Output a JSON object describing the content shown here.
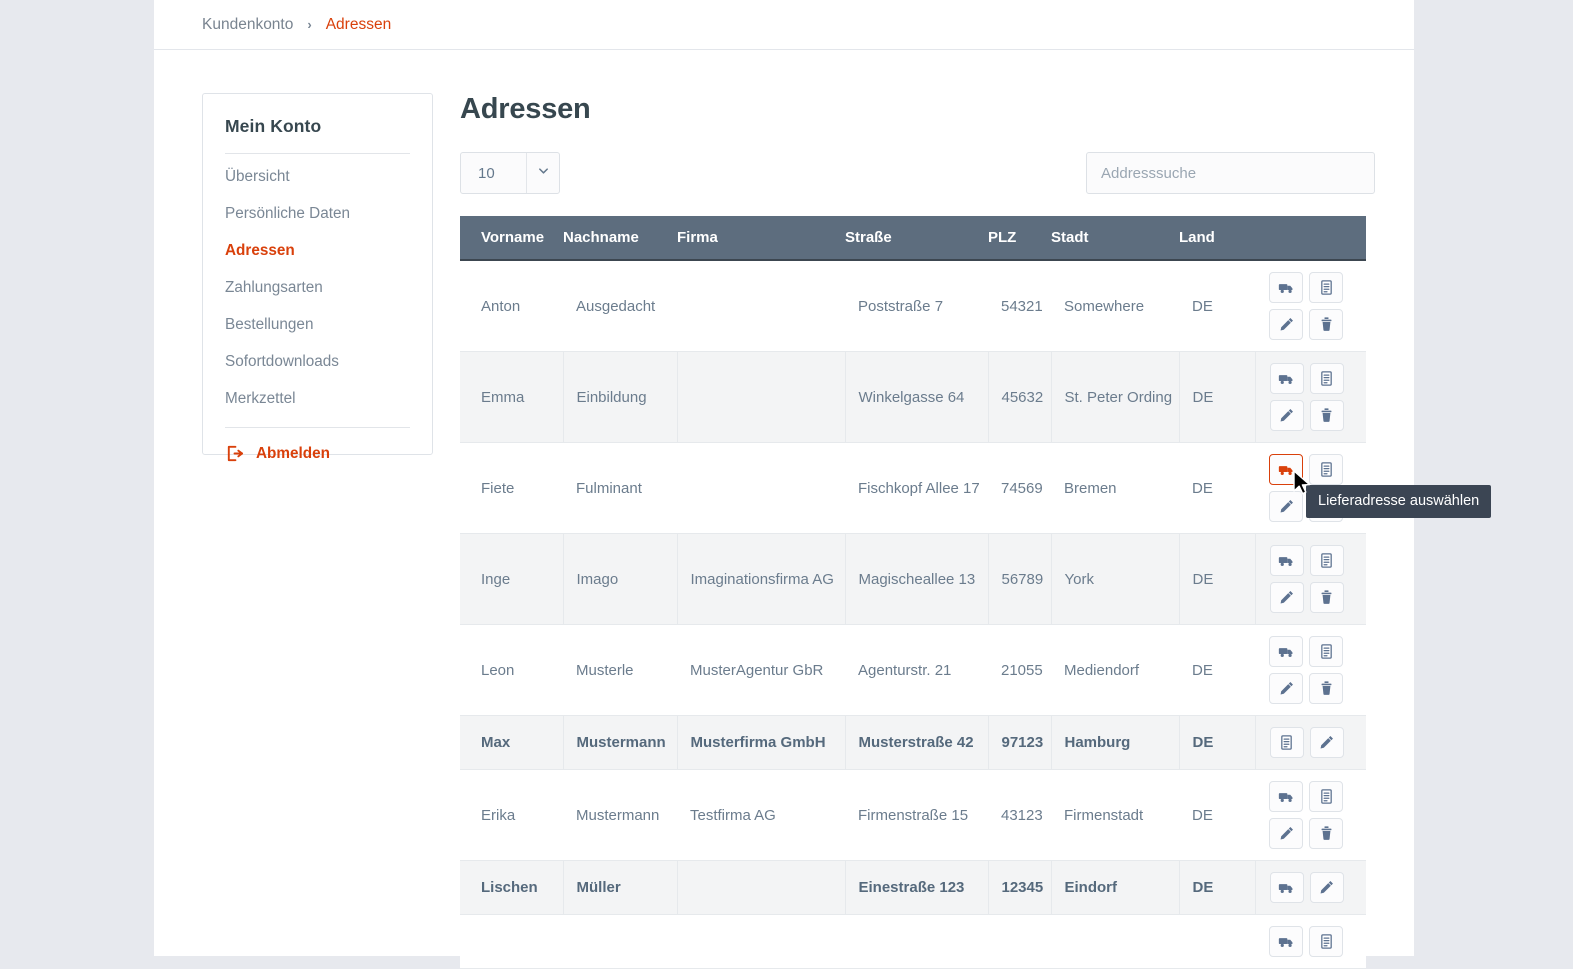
{
  "breadcrumb": {
    "root": "Kundenkonto",
    "separator": "›",
    "current": "Adressen"
  },
  "sidebar": {
    "title": "Mein Konto",
    "items": [
      {
        "label": "Übersicht",
        "active": false
      },
      {
        "label": "Persönliche Daten",
        "active": false
      },
      {
        "label": "Adressen",
        "active": true
      },
      {
        "label": "Zahlungsarten",
        "active": false
      },
      {
        "label": "Bestellungen",
        "active": false
      },
      {
        "label": "Sofortdownloads",
        "active": false
      },
      {
        "label": "Merkzettel",
        "active": false
      }
    ],
    "logout": {
      "label": "Abmelden",
      "icon": "logout-icon"
    }
  },
  "main": {
    "title": "Adressen",
    "page_size": {
      "value": "10",
      "icon": "chevron-down-icon"
    },
    "search": {
      "value": "",
      "placeholder": "Addresssuche",
      "name": "address-search"
    }
  },
  "table": {
    "columns": [
      "Vorname",
      "Nachname",
      "Firma",
      "Straße",
      "PLZ",
      "Stadt",
      "Land",
      ""
    ],
    "rows": [
      {
        "vorname": "Anton",
        "nachname": "Ausgedacht",
        "firma": "",
        "strasse": "Poststraße 7",
        "plz": "54321",
        "stadt": "Somewhere",
        "land": "DE",
        "bold": false,
        "stripe": "odd",
        "actions": [
          "truck-icon",
          "document-icon",
          "pencil-icon",
          "trash-icon"
        ]
      },
      {
        "vorname": "Emma",
        "nachname": "Einbildung",
        "firma": "",
        "strasse": "Winkelgasse 64",
        "plz": "45632",
        "stadt": "St. Peter Ording",
        "land": "DE",
        "bold": false,
        "stripe": "even",
        "actions": [
          "truck-icon",
          "document-icon",
          "pencil-icon",
          "trash-icon"
        ]
      },
      {
        "vorname": "Fiete",
        "nachname": "Fulminant",
        "firma": "",
        "strasse": "Fischkopf Allee 17",
        "plz": "74569",
        "stadt": "Bremen",
        "land": "DE",
        "bold": false,
        "stripe": "odd",
        "actions": [
          "truck-icon",
          "document-icon",
          "pencil-icon",
          "trash-icon"
        ],
        "highlight_action": 0
      },
      {
        "vorname": "Inge",
        "nachname": "Imago",
        "firma": "Imaginationsfirma AG",
        "strasse": "Magischeallee 13",
        "plz": "56789",
        "stadt": "York",
        "land": "DE",
        "bold": false,
        "stripe": "even",
        "actions": [
          "truck-icon",
          "document-icon",
          "pencil-icon",
          "trash-icon"
        ]
      },
      {
        "vorname": "Leon",
        "nachname": "Musterle",
        "firma": "MusterAgentur GbR",
        "strasse": "Agenturstr. 21",
        "plz": "21055",
        "stadt": "Mediendorf",
        "land": "DE",
        "bold": false,
        "stripe": "odd",
        "actions": [
          "truck-icon",
          "document-icon",
          "pencil-icon",
          "trash-icon"
        ]
      },
      {
        "vorname": "Max",
        "nachname": "Mustermann",
        "firma": "Musterfirma GmbH",
        "strasse": "Musterstraße 42",
        "plz": "97123",
        "stadt": "Hamburg",
        "land": "DE",
        "bold": true,
        "stripe": "even",
        "actions": [
          "document-icon",
          "pencil-icon"
        ]
      },
      {
        "vorname": "Erika",
        "nachname": "Mustermann",
        "firma": "Testfirma AG",
        "strasse": "Firmenstraße 15",
        "plz": "43123",
        "stadt": "Firmenstadt",
        "land": "DE",
        "bold": false,
        "stripe": "odd",
        "actions": [
          "truck-icon",
          "document-icon",
          "pencil-icon",
          "trash-icon"
        ]
      },
      {
        "vorname": "Lischen",
        "nachname": "Müller",
        "firma": "",
        "strasse": "Einestraße 123",
        "plz": "12345",
        "stadt": "Eindorf",
        "land": "DE",
        "bold": true,
        "stripe": "even",
        "actions": [
          "truck-icon",
          "pencil-icon"
        ]
      },
      {
        "vorname": "",
        "nachname": "",
        "firma": "",
        "strasse": "",
        "plz": "",
        "stadt": "",
        "land": "",
        "bold": false,
        "stripe": "odd",
        "actions": [
          "truck-icon",
          "document-icon"
        ]
      }
    ]
  },
  "tooltip": {
    "text": "Lieferadresse auswählen"
  },
  "colors": {
    "accent": "#d9400b",
    "table_header_bg": "#5d6d7e",
    "text_muted": "#7a8795",
    "heading": "#37474f",
    "stripe": "#f3f4f5",
    "tooltip_bg": "#3b4553"
  }
}
